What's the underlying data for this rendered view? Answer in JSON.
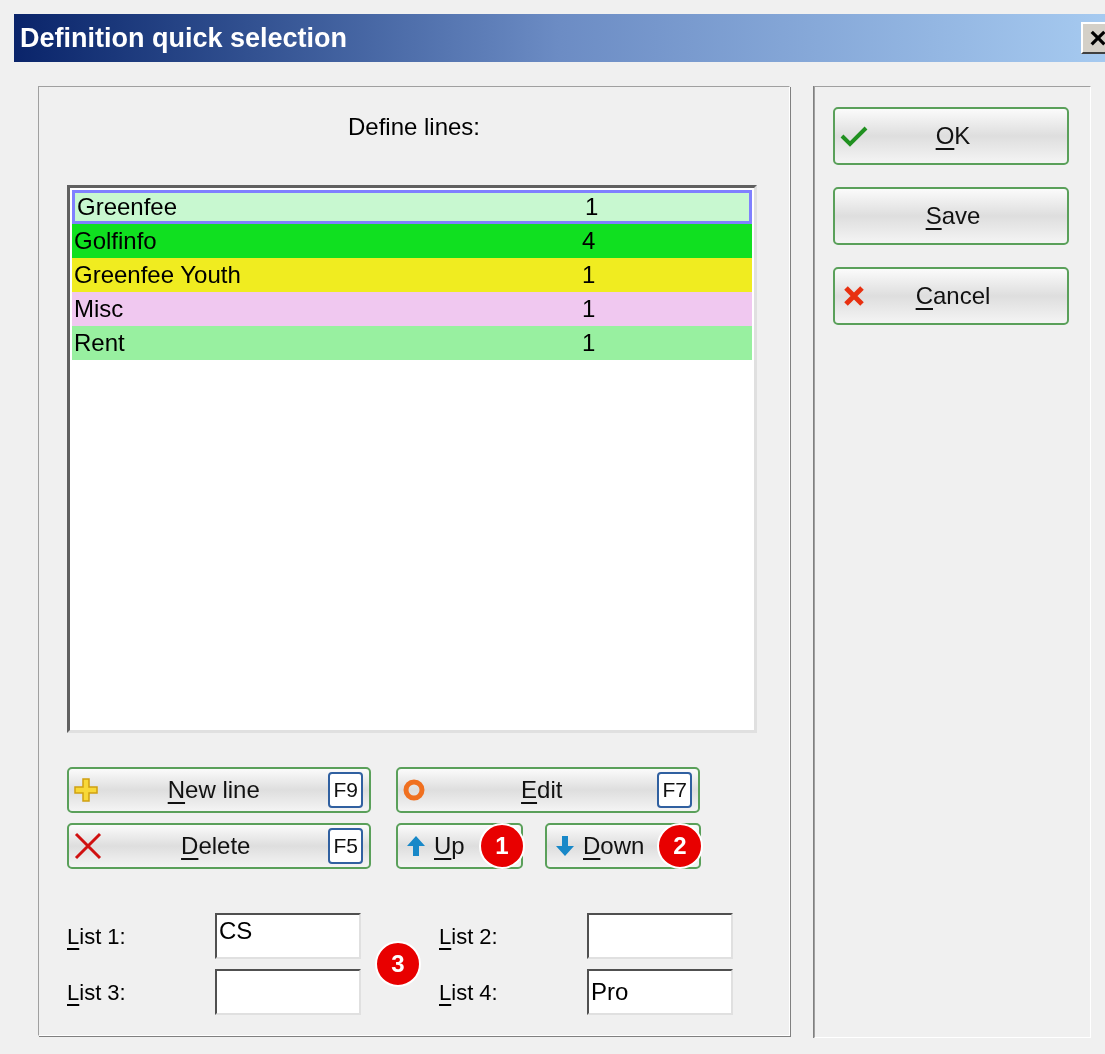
{
  "window": {
    "title": "Definition quick selection",
    "close": "×"
  },
  "heading": "Define lines:",
  "lines": [
    {
      "name": "Greenfee",
      "count": "1",
      "color": "#c8f8d0",
      "selected": true
    },
    {
      "name": "Golfinfo",
      "count": "4",
      "color": "#10e020",
      "selected": false
    },
    {
      "name": "Greenfee Youth",
      "count": "1",
      "color": "#f0ec20",
      "selected": false
    },
    {
      "name": "Misc",
      "count": "1",
      "color": "#f0c8f0",
      "selected": false
    },
    {
      "name": "Rent",
      "count": "1",
      "color": "#98f0a0",
      "selected": false
    }
  ],
  "actions": [
    {
      "kind": "new",
      "label": "New line",
      "key": "F9"
    },
    {
      "kind": "edit",
      "label": "Edit",
      "key": "F7"
    },
    {
      "kind": "delete",
      "label": "Delete",
      "key": "F5"
    },
    {
      "kind": "up",
      "label": "Up",
      "badge": "1"
    },
    {
      "kind": "down",
      "label": "Down",
      "badge": "2"
    }
  ],
  "lists": [
    {
      "label": "List 1:",
      "value": "CS"
    },
    {
      "label": "List 2:"
    },
    {
      "label": "List 3:"
    },
    {
      "label": "List 4:",
      "value": "Pro"
    }
  ],
  "lists_badge": "3",
  "dialog_buttons": [
    {
      "kind": "ok",
      "label": "OK"
    },
    {
      "kind": "save",
      "label": "Save"
    },
    {
      "kind": "cancel",
      "label": "Cancel"
    }
  ]
}
